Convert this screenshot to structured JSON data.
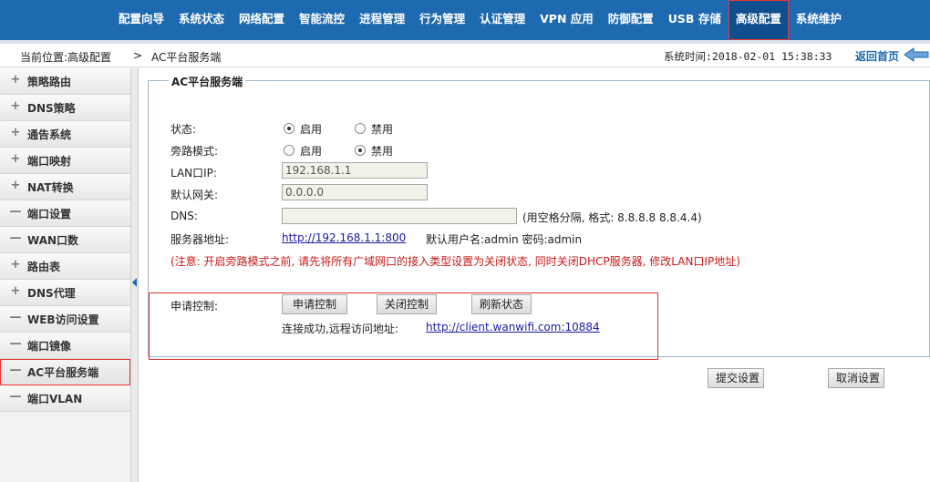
{
  "topnav": {
    "items": [
      "配置向导",
      "系统状态",
      "网络配置",
      "智能流控",
      "进程管理",
      "行为管理",
      "认证管理",
      "VPN 应用",
      "防御配置",
      "USB 存储",
      "高级配置",
      "系统维护"
    ],
    "active_index": 10
  },
  "breadcrumb": {
    "location": "当前位置:高级配置",
    "separator": ">",
    "page": "AC平台服务端",
    "system_time": "系统时间:2018-02-01 15:38:33",
    "home_label": "返回首页"
  },
  "sidebar": {
    "items": [
      {
        "sym": "+",
        "label": "策略路由"
      },
      {
        "sym": "+",
        "label": "DNS策略"
      },
      {
        "sym": "+",
        "label": "通告系统"
      },
      {
        "sym": "+",
        "label": "端口映射"
      },
      {
        "sym": "+",
        "label": "NAT转换"
      },
      {
        "sym": "—",
        "label": "端口设置"
      },
      {
        "sym": "—",
        "label": "WAN口数"
      },
      {
        "sym": "+",
        "label": "路由表"
      },
      {
        "sym": "+",
        "label": "DNS代理"
      },
      {
        "sym": "—",
        "label": "WEB访问设置"
      },
      {
        "sym": "—",
        "label": "端口镜像"
      },
      {
        "sym": "—",
        "label": "AC平台服务端"
      },
      {
        "sym": "—",
        "label": "端口VLAN"
      }
    ],
    "active_index": 11
  },
  "panel": {
    "title": "AC平台服务端",
    "status_label": "状态:",
    "status_on": "启用",
    "status_off": "禁用",
    "bypass_label": "旁路模式:",
    "bypass_on": "启用",
    "bypass_off": "禁用",
    "lan_label": "LAN口IP:",
    "lan_value": "192.168.1.1",
    "gateway_label": "默认网关:",
    "gateway_value": "0.0.0.0",
    "dns_label": "DNS:",
    "dns_value": "",
    "dns_hint": "(用空格分隔, 格式: 8.8.8.8 8.8.4.4)",
    "server_label": "服务器地址:",
    "server_link": "http://192.168.1.1:800",
    "server_cred": "默认用户名:admin 密码:admin",
    "note": "(注意: 开启旁路模式之前, 请先将所有广域网口的接入类型设置为关闭状态, 同时关闭DHCP服务器, 修改LAN口IP地址)",
    "apply_label": "申请控制:",
    "btn_apply": "申请控制",
    "btn_close": "关闭控制",
    "btn_refresh": "刷新状态",
    "conn_text": "连接成功,远程访问地址:",
    "conn_link": "http://client.wanwifi.com:10884"
  },
  "footer": {
    "submit": "提交设置",
    "cancel": "取消设置"
  },
  "colors": {
    "nav_bg": "#1e6ab0",
    "highlight": "#dd3333",
    "link": "#1a1aa6",
    "note": "#cc1a1a"
  }
}
